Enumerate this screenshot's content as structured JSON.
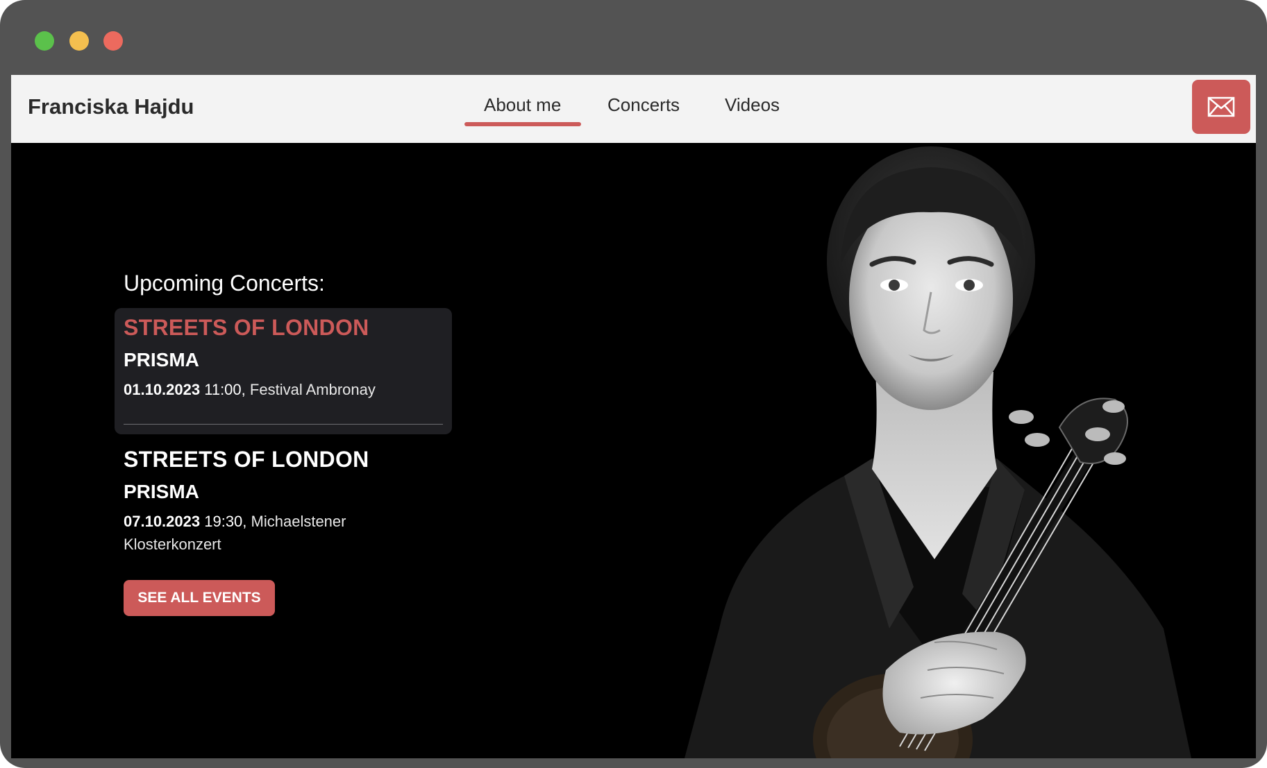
{
  "window": {
    "controls": [
      {
        "name": "green",
        "color": "#5bc14b"
      },
      {
        "name": "yellow",
        "color": "#f4bf4f"
      },
      {
        "name": "red",
        "color": "#ec6a5e"
      }
    ]
  },
  "colors": {
    "accent": "#cc5a59",
    "nav_bg": "#f3f3f3",
    "card_bg": "#1f1f23"
  },
  "nav": {
    "brand": "Franciska Hajdu",
    "items": [
      {
        "label": "About me",
        "active": true
      },
      {
        "label": "Concerts",
        "active": false
      },
      {
        "label": "Videos",
        "active": false
      }
    ],
    "mail_icon": "envelope-icon"
  },
  "hero": {
    "upcoming_title": "Upcoming Concerts:",
    "events": [
      {
        "title": "STREETS OF LONDON",
        "subtitle": "PRISMA",
        "date": "01.10.2023",
        "time": "11:00,",
        "venue": "Festival Ambronay",
        "highlighted": true
      },
      {
        "title": "STREETS OF LONDON",
        "subtitle": "PRISMA",
        "date": "07.10.2023",
        "time": "19:30,",
        "venue": "Michaelstener Klosterkonzert",
        "highlighted": false
      }
    ],
    "cta": "SEE ALL EVENTS",
    "portrait_icon": "violinist-portrait-image"
  }
}
